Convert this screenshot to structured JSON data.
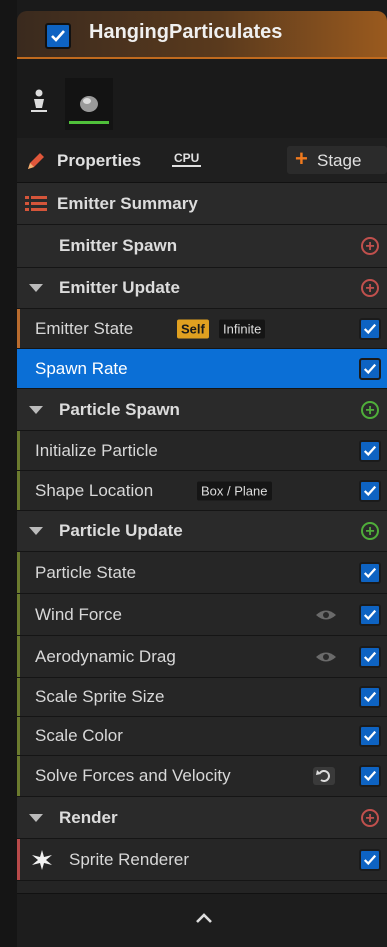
{
  "emitter": {
    "title": "HangingParticulates",
    "enabled": true
  },
  "tabs": [
    {
      "name": "person-icon"
    },
    {
      "name": "sprite-preview-icon",
      "active": true
    }
  ],
  "properties": {
    "label": "Properties",
    "sim_target": "CPU",
    "stage_label": "Stage"
  },
  "summary": {
    "label": "Emitter Summary"
  },
  "rows": [
    {
      "kind": "header-plain",
      "label": "Emitter Spawn",
      "add": "red"
    },
    {
      "kind": "section",
      "label": "Emitter Update",
      "add": "red"
    },
    {
      "kind": "module",
      "label": "Emitter State",
      "badges": [
        "Self",
        "Infinite"
      ],
      "enabled": true,
      "group": "update"
    },
    {
      "kind": "module",
      "label": "Spawn Rate",
      "enabled": true,
      "selected": true,
      "group": "update"
    },
    {
      "kind": "section",
      "label": "Particle Spawn",
      "add": "green"
    },
    {
      "kind": "module",
      "label": "Initialize Particle",
      "enabled": true,
      "group": "particle"
    },
    {
      "kind": "module",
      "label": "Shape Location",
      "badges": [
        "Box / Plane"
      ],
      "enabled": true,
      "group": "particle"
    },
    {
      "kind": "section",
      "label": "Particle Update",
      "add": "green"
    },
    {
      "kind": "module",
      "label": "Particle State",
      "enabled": true,
      "group": "particle"
    },
    {
      "kind": "module",
      "label": "Wind Force",
      "enabled": true,
      "eye": true,
      "group": "particle"
    },
    {
      "kind": "module",
      "label": "Aerodynamic Drag",
      "enabled": true,
      "eye": true,
      "group": "particle"
    },
    {
      "kind": "module",
      "label": "Scale Sprite Size",
      "enabled": true,
      "group": "particle"
    },
    {
      "kind": "module",
      "label": "Scale Color",
      "enabled": true,
      "group": "particle"
    },
    {
      "kind": "module",
      "label": "Solve Forces and Velocity",
      "enabled": true,
      "reset": true,
      "group": "particle"
    },
    {
      "kind": "section",
      "label": "Render",
      "add": "red"
    },
    {
      "kind": "renderer",
      "label": "Sprite Renderer",
      "enabled": true
    }
  ],
  "colors": {
    "accent_blue": "#0b6fd6",
    "emitter_update": "#b86b2e",
    "particle_group": "#6b7a2e",
    "render_group": "#b84a4a",
    "add_red": "#c0504d",
    "add_green": "#4fae3a"
  },
  "footer": {
    "icon": "chevron-up-icon"
  }
}
